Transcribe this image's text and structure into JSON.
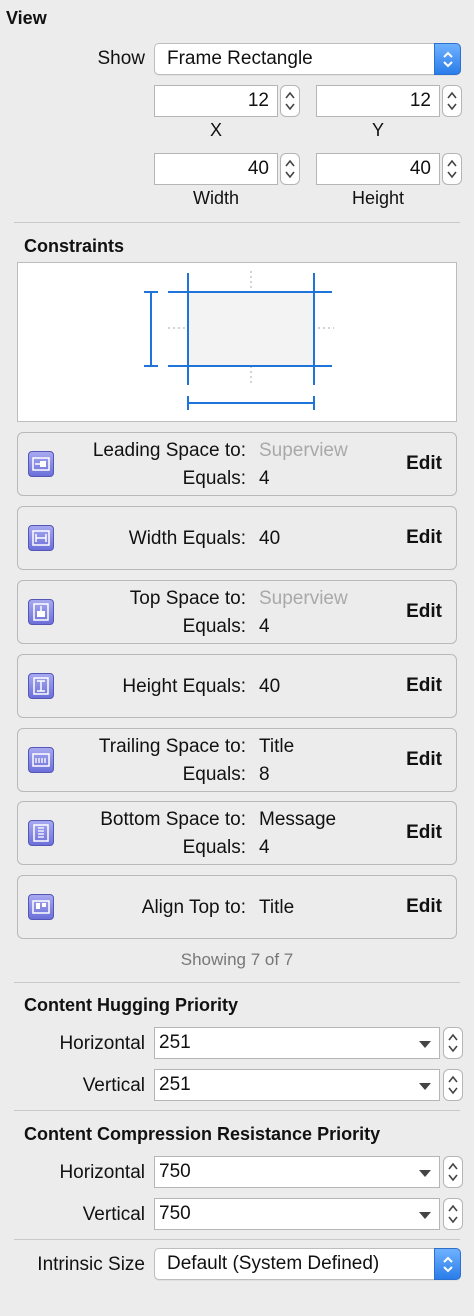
{
  "view": {
    "title": "View",
    "show_label": "Show",
    "show_value": "Frame Rectangle",
    "x_value": "12",
    "y_value": "12",
    "x_label": "X",
    "y_label": "Y",
    "width_value": "40",
    "height_value": "40",
    "width_label": "Width",
    "height_label": "Height"
  },
  "constraints": {
    "title": "Constraints",
    "edit_label": "Edit",
    "items": [
      {
        "label1": "Leading Space to:",
        "value1": "Superview",
        "label2": "Equals:",
        "value2": "4",
        "icon": "leading-space-icon"
      },
      {
        "label1": "Width Equals:",
        "value1": "40",
        "icon": "width-icon"
      },
      {
        "label1": "Top Space to:",
        "value1": "Superview",
        "label2": "Equals:",
        "value2": "4",
        "icon": "top-space-icon"
      },
      {
        "label1": "Height Equals:",
        "value1": "40",
        "icon": "height-icon"
      },
      {
        "label1": "Trailing Space to:",
        "value1": "Title",
        "label2": "Equals:",
        "value2": "8",
        "icon": "trailing-space-icon"
      },
      {
        "label1": "Bottom Space to:",
        "value1": "Message",
        "label2": "Equals:",
        "value2": "4",
        "icon": "bottom-space-icon"
      },
      {
        "label1": "Align Top to:",
        "value1": "Title",
        "icon": "align-top-icon"
      }
    ],
    "showing": "Showing 7 of 7"
  },
  "hugging": {
    "title": "Content Hugging Priority",
    "horizontal_label": "Horizontal",
    "horizontal_value": "251",
    "vertical_label": "Vertical",
    "vertical_value": "251"
  },
  "compression": {
    "title": "Content Compression Resistance Priority",
    "horizontal_label": "Horizontal",
    "horizontal_value": "750",
    "vertical_label": "Vertical",
    "vertical_value": "750"
  },
  "intrinsic": {
    "label": "Intrinsic Size",
    "value": "Default (System Defined)"
  },
  "colors": {
    "accent": "#2a7de9",
    "constraint_line": "#1f74d9",
    "icon": "#7a7de0"
  }
}
